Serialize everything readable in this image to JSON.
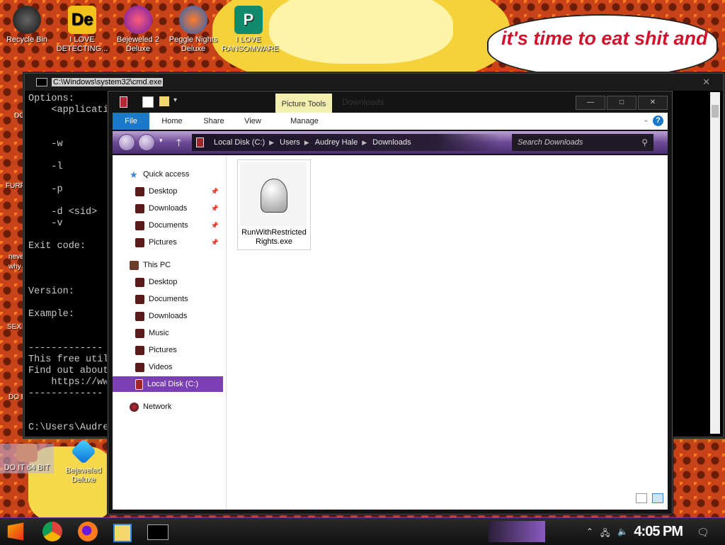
{
  "desktop": {
    "icons": [
      {
        "label": "Recycle Bin",
        "icon": "recycle-bin-icon"
      },
      {
        "label": "I LOVE DETECTING...",
        "icon": "de-icon"
      },
      {
        "label": "Bejeweled 2 Deluxe",
        "icon": "bejeweled-icon"
      },
      {
        "label": "Peggle Nights Deluxe",
        "icon": "peggle-icon"
      },
      {
        "label": "I LOVE RANSOMWARE",
        "icon": "publisher-icon"
      },
      {
        "label": "DO IT 64 BIT",
        "icon": "portrait-icon"
      },
      {
        "label": "Bejeweled Deluxe",
        "icon": "bejeweled-deluxe-icon"
      }
    ],
    "partial_labels": [
      "DO",
      "FURF",
      "neve",
      "why",
      "SEX",
      "DO I"
    ],
    "bubble_text": "it's time to eat shit and die and chew"
  },
  "cmd": {
    "title": "C:\\Windows\\system32\\cmd.exe",
    "lines": [
      "Options:",
      "    <applicati",
      "",
      "",
      "    -w",
      "",
      "    -l",
      "",
      "    -p",
      "",
      "    -d <sid>",
      "    -v",
      "",
      "Exit code:",
      "",
      "",
      "",
      "Version:",
      "",
      "Example:",
      "",
      "",
      "-------------",
      "This free util",
      "Find out about",
      "    https://ww",
      "-------------",
      "",
      "",
      "C:\\Users\\Audre"
    ]
  },
  "explorer": {
    "title": "Downloads",
    "context_tab": "Picture Tools",
    "tabs": [
      "File",
      "Home",
      "Share",
      "View",
      "Manage"
    ],
    "breadcrumb": [
      "Local Disk (C:)",
      "Users",
      "Audrey Hale",
      "Downloads"
    ],
    "search_placeholder": "Search Downloads",
    "nav": {
      "quick_access": "Quick access",
      "quick_items": [
        "Desktop",
        "Downloads",
        "Documents",
        "Pictures"
      ],
      "this_pc": "This PC",
      "pc_items": [
        "Desktop",
        "Documents",
        "Downloads",
        "Music",
        "Pictures",
        "Videos"
      ],
      "local_disk": "Local Disk (C:)",
      "network": "Network"
    },
    "files": [
      {
        "name": "RunWithRestrictedRights.exe",
        "icon": "helmet-icon"
      }
    ]
  },
  "taskbar": {
    "time": "4:05 PM"
  },
  "colors": {
    "accent": "#7a3fb2",
    "file_tab": "#1979ca",
    "context_tab": "#f2efb0"
  }
}
